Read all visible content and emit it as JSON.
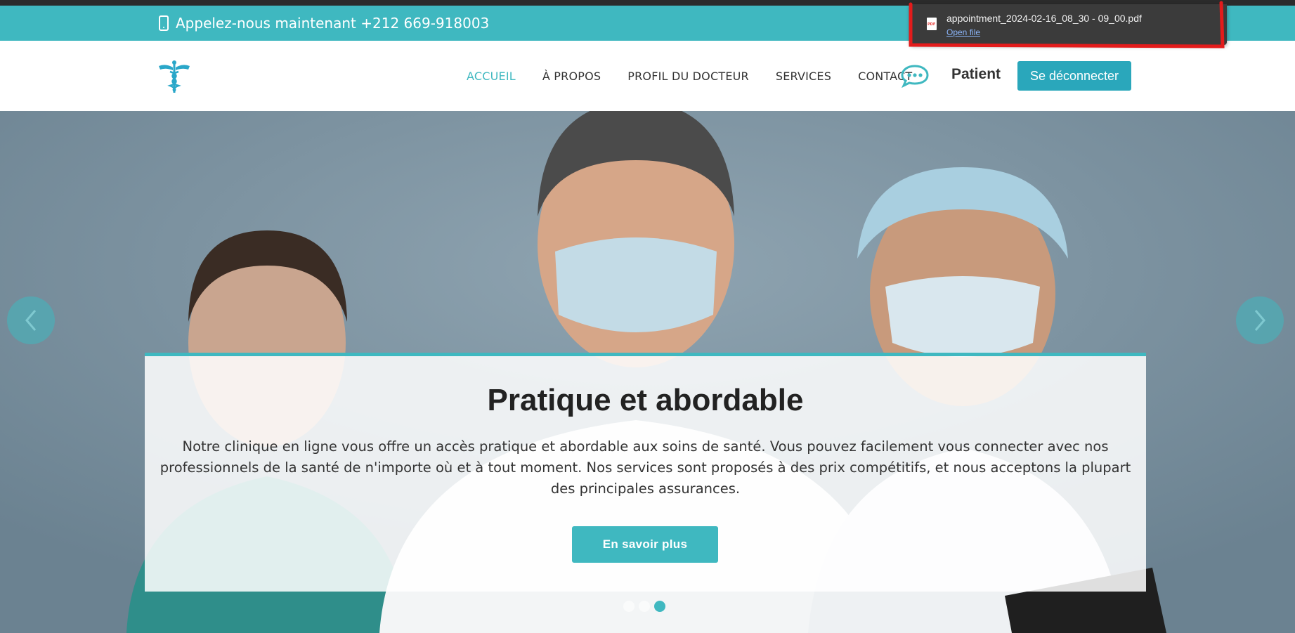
{
  "colors": {
    "accent": "#3fb8c0",
    "logout_button": "#2aa7bb",
    "nav_text": "#333333",
    "download_bar": "#3b3b3b",
    "annotation": "#e31b1b"
  },
  "topbar": {
    "icon": "mobile-phone-icon",
    "call_text": "Appelez-nous maintenant +212 669-918003"
  },
  "nav": {
    "logo": "caduceus-logo",
    "items": [
      {
        "label": "ACCUEIL",
        "active": true
      },
      {
        "label": "À PROPOS",
        "active": false
      },
      {
        "label": "PROFIL DU DOCTEUR",
        "active": false
      },
      {
        "label": "SERVICES",
        "active": false
      },
      {
        "label": "CONTACT",
        "active": false
      }
    ],
    "chat_icon": "chat-bubble-icon",
    "user_label": "Patient",
    "logout_label": "Se déconnecter"
  },
  "hero": {
    "title": "Pratique et abordable",
    "text": "Notre clinique en ligne vous offre un accès pratique et abordable aux soins de santé. Vous pouvez facilement vous connecter avec nos professionnels de la santé de n'importe où et à tout moment. Nos services sont proposés à des prix compétitifs, et nous acceptons la plupart des principales assurances.",
    "cta_label": "En savoir plus",
    "slides": 3,
    "active_slide": 3,
    "prev_icon": "chevron-left-icon",
    "next_icon": "chevron-right-icon"
  },
  "download": {
    "icon": "pdf-file-icon",
    "filename": "appointment_2024-02-16_08_30 - 09_00.pdf",
    "open_label": "Open file"
  }
}
